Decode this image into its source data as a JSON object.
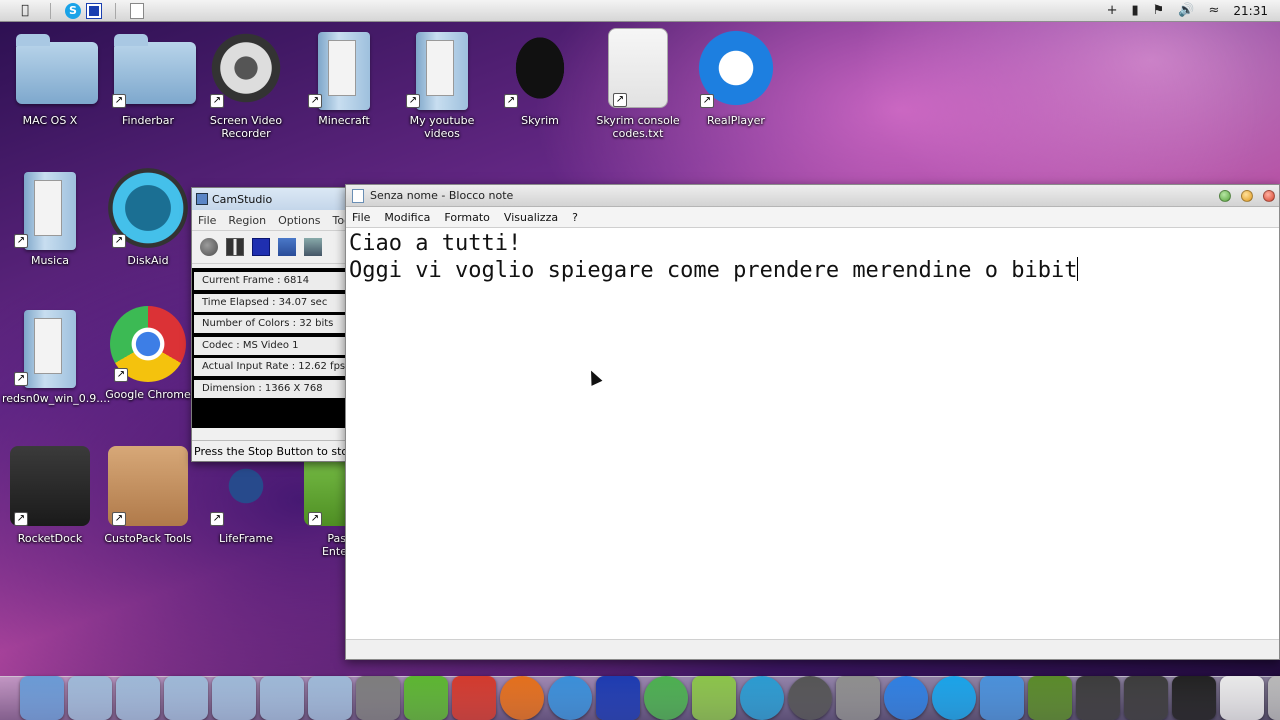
{
  "menubar": {
    "apple_icon": "apple-icon",
    "time": "21:31",
    "status_icons": [
      "plus-icon",
      "battery-icon",
      "flag-icon",
      "volume-icon",
      "wifi-icon"
    ]
  },
  "desktop_icons": [
    {
      "label": "MAC OS X",
      "icon": "folder-icon",
      "col": 0,
      "row": 0
    },
    {
      "label": "Finderbar",
      "icon": "folder-icon",
      "col": 1,
      "row": 0
    },
    {
      "label": "Screen Video Recorder",
      "icon": "film-reel-icon",
      "col": 2,
      "row": 0
    },
    {
      "label": "Minecraft",
      "icon": "folder-icon",
      "col": 3,
      "row": 0
    },
    {
      "label": "My youtube videos",
      "icon": "folder-icon",
      "col": 4,
      "row": 0
    },
    {
      "label": "Skyrim",
      "icon": "skyrim-icon",
      "col": 5,
      "row": 0
    },
    {
      "label": "Skyrim console codes.txt",
      "icon": "text-file-icon",
      "col": 6,
      "row": 0
    },
    {
      "label": "RealPlayer",
      "icon": "realplayer-icon",
      "col": 7,
      "row": 0
    },
    {
      "label": "Musica",
      "icon": "music-folder-icon",
      "col": 0,
      "row": 1
    },
    {
      "label": "DiskAid",
      "icon": "usb-icon",
      "col": 1,
      "row": 1
    },
    {
      "label": "redsn0w_win_0.9....",
      "icon": "folder-icon",
      "col": 0,
      "row": 2
    },
    {
      "label": "Google Chrome",
      "icon": "chrome-icon",
      "col": 1,
      "row": 2
    },
    {
      "label": "RocketDock",
      "icon": "rocketdock-icon",
      "col": 0,
      "row": 3
    },
    {
      "label": "CustoPack Tools",
      "icon": "custopack-icon",
      "col": 1,
      "row": 3
    },
    {
      "label": "LifeFrame",
      "icon": "lifeframe-icon",
      "col": 2,
      "row": 3
    },
    {
      "label": "Passw\nEnterpri",
      "icon": "password-icon",
      "col": 3,
      "row": 3
    }
  ],
  "camstudio": {
    "title": "CamStudio",
    "menu": [
      "File",
      "Region",
      "Options",
      "Too"
    ],
    "stats": [
      "Current Frame : 6814",
      "Time Elapsed : 34.07 sec",
      "Number of Colors : 32 bits",
      "Codec : MS Video 1",
      "Actual Input Rate : 12.62 fps",
      "Dimension : 1366 X 768"
    ],
    "status": "Press the Stop Button to stop re"
  },
  "notepad": {
    "title": "Senza nome - Blocco note",
    "menu": [
      "File",
      "Modifica",
      "Formato",
      "Visualizza",
      "?"
    ],
    "line1": "Ciao a tutti!",
    "line2": "Oggi vi voglio spiegare come prendere merendine o bibit"
  },
  "dock_items": [
    {
      "icon": "imac-icon",
      "color": "#6a9ad4"
    },
    {
      "icon": "stack-icon",
      "color": "#9db8d6"
    },
    {
      "icon": "music-stack-icon",
      "color": "#9db8d6"
    },
    {
      "icon": "photo-stack-icon",
      "color": "#9db8d6"
    },
    {
      "icon": "folder-stack-icon",
      "color": "#9db8d6"
    },
    {
      "icon": "folder-stack-icon",
      "color": "#9db8d6"
    },
    {
      "icon": "folder-stack-icon",
      "color": "#9db8d6"
    },
    {
      "icon": "settings-icon",
      "color": "#7d7d7d"
    },
    {
      "icon": "utorrent-icon",
      "color": "#5cb531"
    },
    {
      "icon": "game-icon",
      "color": "#d23a2d"
    },
    {
      "icon": "firefox-icon",
      "color": "#e36f1c"
    },
    {
      "icon": "safari-icon",
      "color": "#3a8fd8"
    },
    {
      "icon": "teamviewer-icon",
      "color": "#1d3bb0"
    },
    {
      "icon": "chrome-icon",
      "color": "#4caf50"
    },
    {
      "icon": "android-icon",
      "color": "#8bc34a"
    },
    {
      "icon": "usb-icon",
      "color": "#2b9bd0"
    },
    {
      "icon": "audio-icon",
      "color": "#555555"
    },
    {
      "icon": "fun-icon",
      "color": "#8e8e8e"
    },
    {
      "icon": "thunder-icon",
      "color": "#2f7fe0"
    },
    {
      "icon": "skype-icon",
      "color": "#1aa3e8"
    },
    {
      "icon": "finder-icon",
      "color": "#4a90d9"
    },
    {
      "icon": "minecraft-icon",
      "color": "#5a8a2a"
    },
    {
      "icon": "cod-icon",
      "color": "#3c3c3c"
    },
    {
      "icon": "cod-icon",
      "color": "#3c3c3c"
    },
    {
      "icon": "skyrim-icon",
      "color": "#222222"
    },
    {
      "icon": "document-icon",
      "color": "#e8e8e8"
    },
    {
      "icon": "trash-icon",
      "color": "#b8b8b8"
    }
  ]
}
